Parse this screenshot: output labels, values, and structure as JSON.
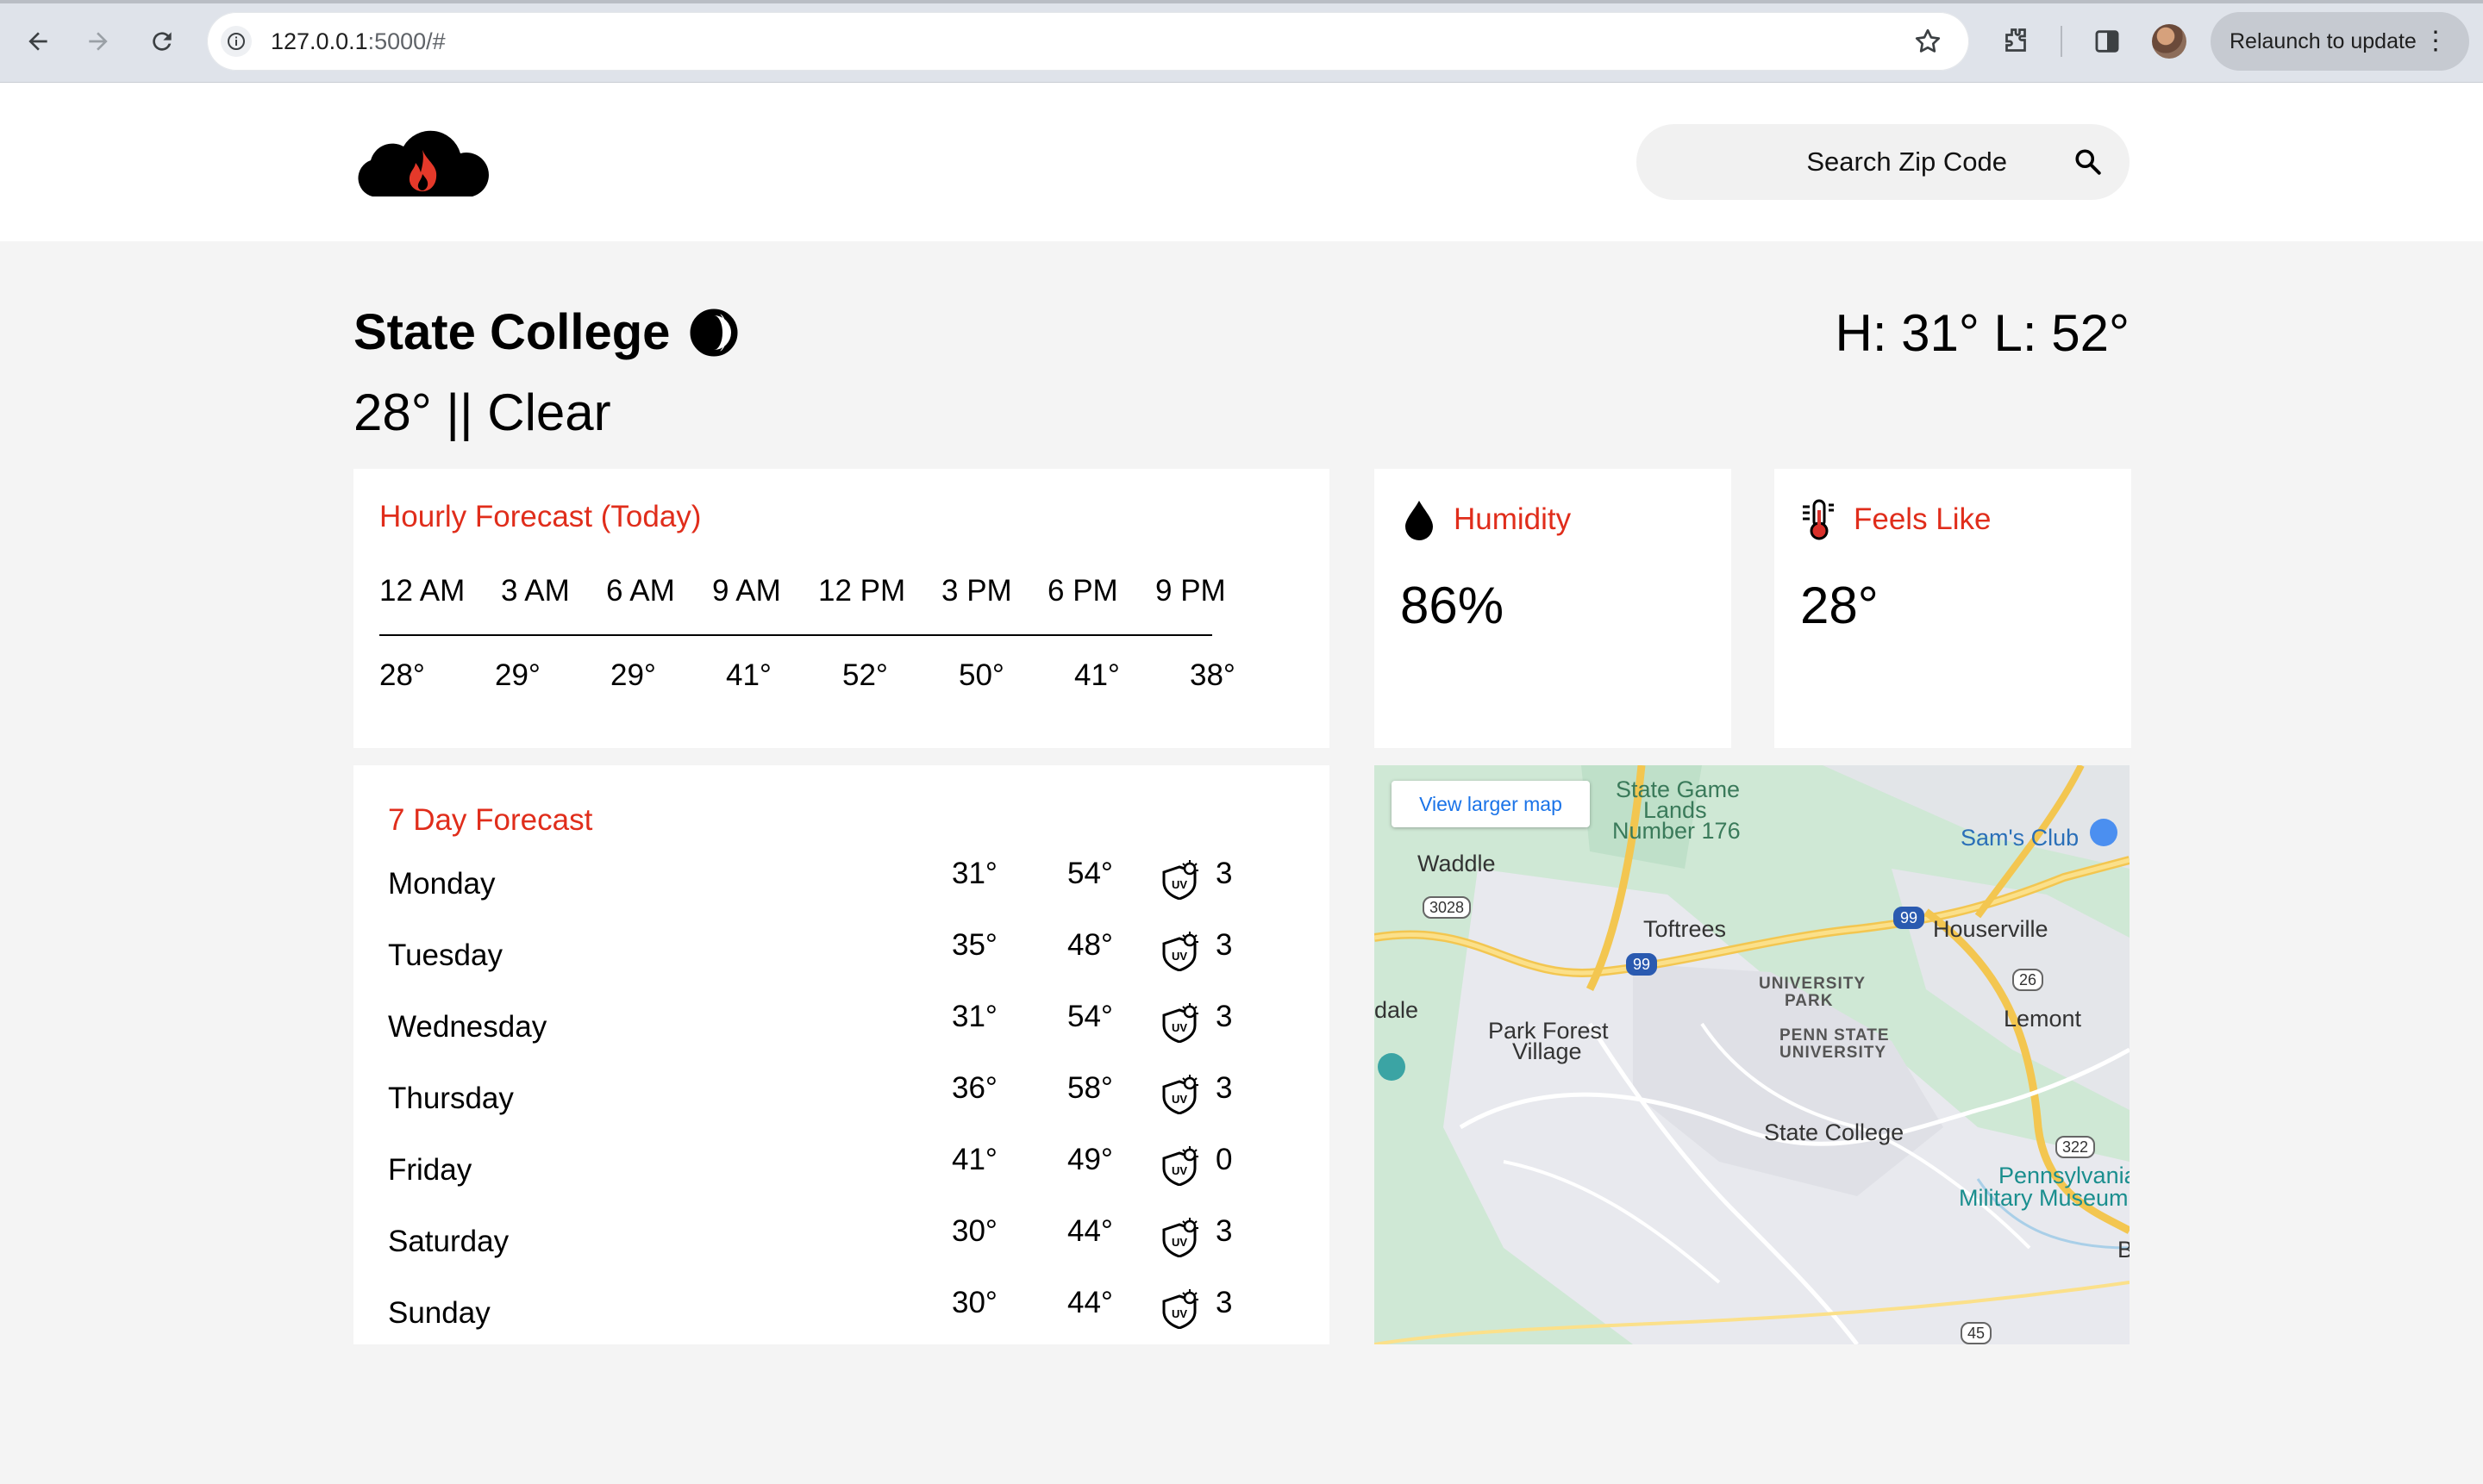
{
  "browser": {
    "url_host": "127.0.0.1",
    "url_rest": ":5000/#",
    "relaunch_label": "Relaunch to update"
  },
  "header": {
    "search_placeholder": "Search Zip Code"
  },
  "current": {
    "city": "State College",
    "high_low": "H: 31° L: 52°",
    "condition": "28° || Clear"
  },
  "hourly": {
    "title": "Hourly Forecast (Today)",
    "times": [
      "12 AM",
      "3 AM",
      "6 AM",
      "9 AM",
      "12 PM",
      "3 PM",
      "6 PM",
      "9 PM"
    ],
    "temps": [
      "28°",
      "29°",
      "29°",
      "41°",
      "52°",
      "50°",
      "41°",
      "38°"
    ]
  },
  "humidity": {
    "title": "Humidity",
    "value": "86%",
    "icon": "water-drop-icon"
  },
  "feels_like": {
    "title": "Feels Like",
    "value": "28°",
    "icon": "thermometer-icon"
  },
  "weekly": {
    "title": "7 Day Forecast",
    "days": [
      {
        "day": "Monday",
        "hi": "31°",
        "lo": "54°",
        "uv": "3"
      },
      {
        "day": "Tuesday",
        "hi": "35°",
        "lo": "48°",
        "uv": "3"
      },
      {
        "day": "Wednesday",
        "hi": "31°",
        "lo": "54°",
        "uv": "3"
      },
      {
        "day": "Thursday",
        "hi": "36°",
        "lo": "58°",
        "uv": "3"
      },
      {
        "day": "Friday",
        "hi": "41°",
        "lo": "49°",
        "uv": "0"
      },
      {
        "day": "Saturday",
        "hi": "30°",
        "lo": "44°",
        "uv": "3"
      },
      {
        "day": "Sunday",
        "hi": "30°",
        "lo": "44°",
        "uv": "3"
      }
    ]
  },
  "map": {
    "view_larger": "View larger map",
    "labels": {
      "waddle": "Waddle",
      "sgl1": "State Game",
      "sgl2": "Lands",
      "sgl3": "Number 176",
      "toftrees": "Toftrees",
      "sams": "Sam's Club",
      "houserville": "Houserville",
      "up1": "UNIVERSITY",
      "up2": "PARK",
      "psu1": "PENN STATE",
      "psu2": "UNIVERSITY",
      "lemont": "Lemont",
      "dale": "dale",
      "pfv1": "Park Forest",
      "pfv2": "Village",
      "state_college": "State College",
      "pmm1": "Pennsylvania",
      "pmm2": "Military Museum",
      "edge_b": "B",
      "r3028": "3028",
      "r99a": "99",
      "r99b": "99",
      "r26": "26",
      "r322": "322",
      "r45": "45"
    }
  },
  "colors": {
    "accent": "#e02d1b",
    "background": "#f4f4f4",
    "card": "#ffffff"
  }
}
